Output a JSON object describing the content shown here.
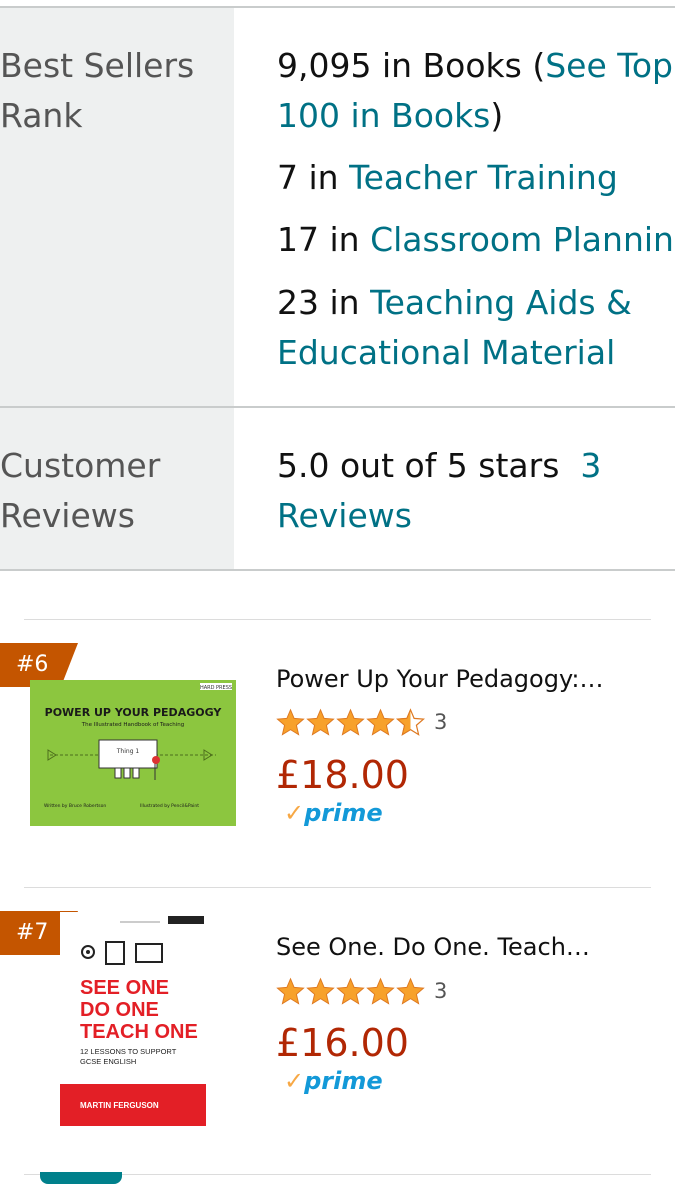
{
  "details": {
    "best_sellers": {
      "label_line1": "Best Sellers",
      "label_line2": "Rank",
      "main_rank": "9,095 in Books (",
      "top100_link_part1": "See Top",
      "top100_link_part2": "100 in Books",
      "main_rank_close": ")",
      "categories": [
        {
          "rank": "7 in ",
          "name": "Teacher Training"
        },
        {
          "rank": "17 in ",
          "name": "Classroom Planning"
        },
        {
          "rank": "23 in ",
          "name_line1": "Teaching Aids &",
          "name_line2": "Educational Material"
        }
      ]
    },
    "customer_reviews": {
      "label_line1": "Customer",
      "label_line2": "Reviews",
      "rating_text": "5.0 out of 5 stars",
      "reviews_link_part1": "3",
      "reviews_link_part2": "Reviews"
    }
  },
  "related_books": [
    {
      "badge": "#6",
      "title": "Power Up Your Pedagogy:…",
      "rating": 4.5,
      "review_count": "3",
      "price": "£18.00",
      "prime_label": "prime",
      "cover": {
        "bg": "#8cc63f",
        "top_tag": "HARD PRESS",
        "title": "POWER UP YOUR PEDAGOGY",
        "subtitle": "The Illustrated Handbook of Teaching",
        "sign": "Thing 1",
        "footer_left": "Written by Bruce Robertson",
        "footer_right": "Illustrated by Pencil&Paint"
      }
    },
    {
      "badge": "#7",
      "title": "See One. Do One. Teach…",
      "rating": 5,
      "review_count": "3",
      "price": "£16.00",
      "prime_label": "prime",
      "cover": {
        "bg": "#ffffff",
        "title_lines": [
          "SEE ONE",
          "DO ONE",
          "TEACH ONE"
        ],
        "subtitle_lines": [
          "12 LESSONS TO SUPPORT",
          "GCSE ENGLISH"
        ],
        "author": "MARTIN FERGUSON",
        "accent": "#e31f26"
      }
    }
  ],
  "colors": {
    "link": "#007185",
    "price": "#b12704",
    "badge": "#c45500",
    "star": "#f7a12b",
    "prime_check": "#f7a845",
    "prime_text": "#1399d8"
  }
}
